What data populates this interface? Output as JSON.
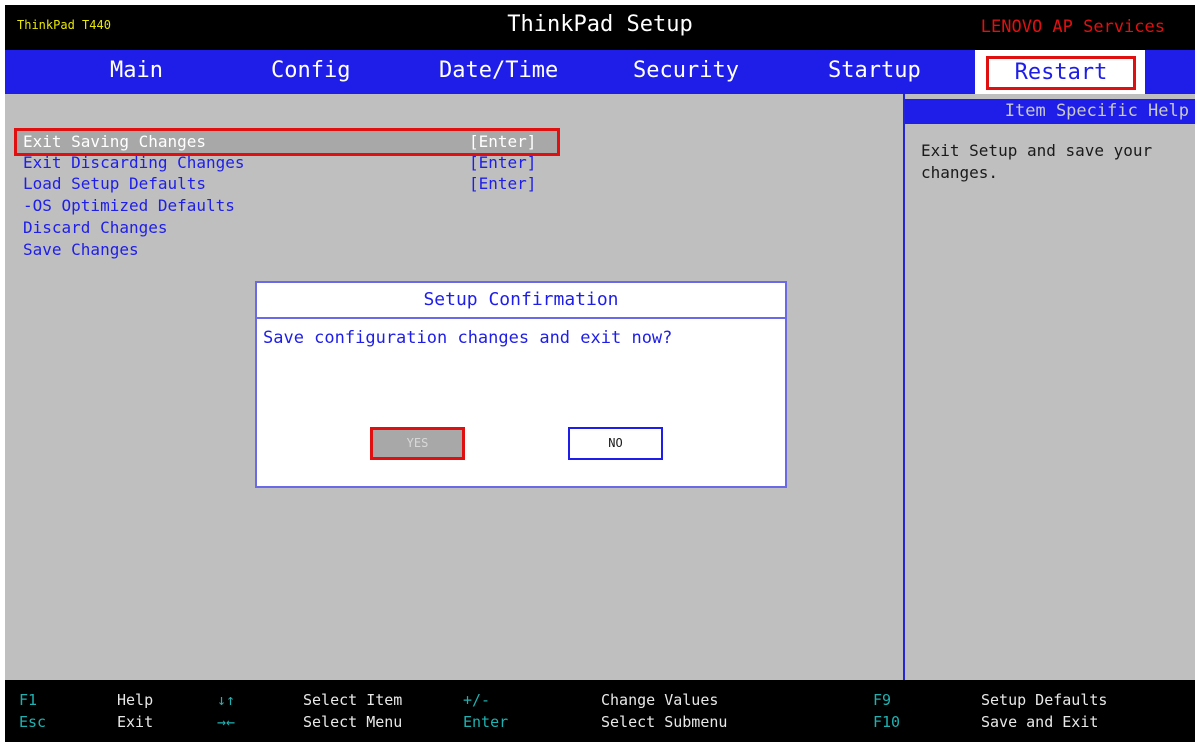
{
  "header": {
    "model": "ThinkPad T440",
    "title": "ThinkPad Setup",
    "vendor": "LENOVO AP Services"
  },
  "menu": {
    "tabs": [
      "Main",
      "Config",
      "Date/Time",
      "Security",
      "Startup",
      "Restart"
    ],
    "active": "Restart"
  },
  "items": [
    {
      "label": "Exit Saving Changes",
      "value": "[Enter]",
      "selected": true
    },
    {
      "label": "Exit Discarding Changes",
      "value": "[Enter]"
    },
    {
      "label": "Load Setup Defaults",
      "value": "[Enter]"
    },
    {
      "label": "-OS Optimized Defaults",
      "value": ""
    },
    {
      "label": "Discard Changes",
      "value": ""
    },
    {
      "label": "Save Changes",
      "value": ""
    }
  ],
  "help": {
    "title": "Item Specific Help",
    "text": "Exit Setup and save your changes."
  },
  "dialog": {
    "title": "Setup Confirmation",
    "message": "Save configuration changes and exit now?",
    "yes_label": "YES",
    "no_label": "NO",
    "selected": "YES"
  },
  "footer": {
    "row1": [
      {
        "key": "F1",
        "desc": "Help"
      },
      {
        "key": "↓↑",
        "desc": "Select Item"
      },
      {
        "key": "+/-",
        "desc": "Change Values"
      },
      {
        "key": "F9",
        "desc": "Setup Defaults"
      }
    ],
    "row2": [
      {
        "key": "Esc",
        "desc": "Exit"
      },
      {
        "key": "→←",
        "desc": "Select Menu"
      },
      {
        "key": "Enter",
        "desc": "Select Submenu"
      },
      {
        "key": "F10",
        "desc": "Save and Exit"
      }
    ]
  },
  "colors": {
    "menu_bar": "#1e1ee8",
    "panel_bg": "#bfbfbf",
    "highlight_border": "#e01010",
    "footer_key": "#1fb1b1"
  }
}
